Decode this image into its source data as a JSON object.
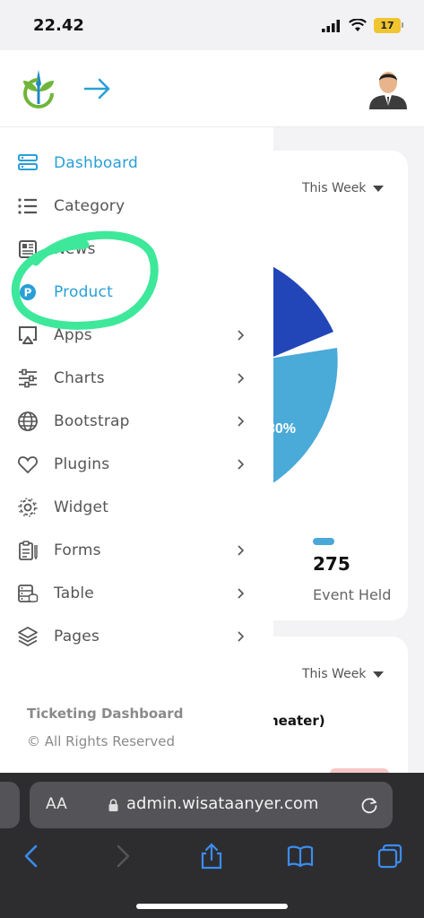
{
  "status_bar": {
    "time": "22.42",
    "battery": "17"
  },
  "header": {
    "logo_icon": "leaf-drop-logo-icon",
    "toggle_icon": "arrow-right-icon",
    "avatar_icon": "user-avatar"
  },
  "sidebar": {
    "items": [
      {
        "label": "Dashboard",
        "icon": "dashboard-icon",
        "active": true,
        "has_submenu": false
      },
      {
        "label": "Category",
        "icon": "list-icon",
        "active": false,
        "has_submenu": false
      },
      {
        "label": "News",
        "icon": "newspaper-icon",
        "active": false,
        "has_submenu": false
      },
      {
        "label": "Product",
        "icon": "product-p-icon",
        "active": true,
        "has_submenu": false
      },
      {
        "label": "Apps",
        "icon": "airplay-icon",
        "active": false,
        "has_submenu": true
      },
      {
        "label": "Charts",
        "icon": "sliders-icon",
        "active": false,
        "has_submenu": true
      },
      {
        "label": "Bootstrap",
        "icon": "globe-icon",
        "active": false,
        "has_submenu": true
      },
      {
        "label": "Plugins",
        "icon": "heart-icon",
        "active": false,
        "has_submenu": true
      },
      {
        "label": "Widget",
        "icon": "gear-icon",
        "active": false,
        "has_submenu": false
      },
      {
        "label": "Forms",
        "icon": "clipboard-icon",
        "active": false,
        "has_submenu": true
      },
      {
        "label": "Table",
        "icon": "database-icon",
        "active": false,
        "has_submenu": true
      },
      {
        "label": "Pages",
        "icon": "layers-icon",
        "active": false,
        "has_submenu": true
      }
    ],
    "footer_title": "Ticketing Dashboard",
    "footer_copy": "© All Rights Reserved"
  },
  "content": {
    "card1_period": "This Week",
    "pie_label": "30%",
    "stat_value": "275",
    "stat_label": "Event Held",
    "card2_period": "This Week",
    "card2_text": "heater)"
  },
  "browser": {
    "text_size": "AA",
    "url": "admin.wisataanyer.com"
  },
  "colors": {
    "accent": "#2a9fd6",
    "highlight": "#3ee89a",
    "pie_dark": "#2246b8",
    "pie_light": "#4aaad8"
  }
}
